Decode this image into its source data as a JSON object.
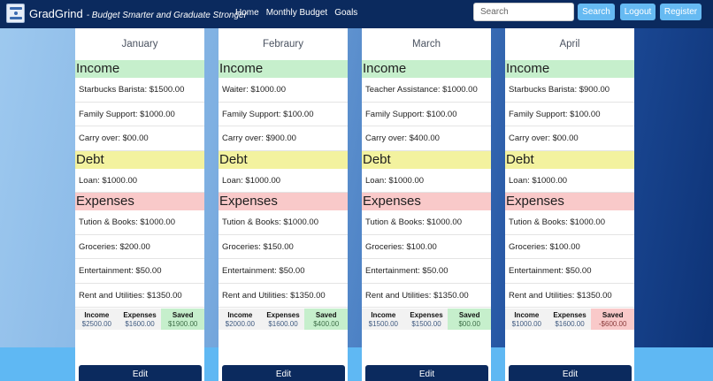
{
  "nav": {
    "brand": "GradGrind",
    "tagline": "- Budget Smarter and Graduate Stronger",
    "links": [
      "Home",
      "Monthly Budget",
      "Goals"
    ],
    "search_placeholder": "Search",
    "search_button": "Search",
    "logout": "Logout",
    "register": "Register",
    "logo_icon": "budget-logo-icon"
  },
  "sections": {
    "income": "Income",
    "debt": "Debt",
    "expenses": "Expenses"
  },
  "summary_labels": {
    "income": "Income",
    "expenses": "Expenses",
    "saved": "Saved"
  },
  "edit_label": "Edit",
  "colors": {
    "navbar": "#0b2a5e",
    "income_header": "#c6efcc",
    "debt_header": "#f3f29f",
    "expenses_header": "#f9c9c9",
    "nav_button": "#66baf2"
  },
  "months": [
    {
      "name": "January",
      "income": [
        "Starbucks Barista: $1500.00",
        "Family Support: $1000.00",
        "Carry over: $00.00"
      ],
      "debt": [
        "Loan: $1000.00"
      ],
      "expenses": [
        "Tution & Books: $1000.00",
        "Groceries: $200.00",
        "Entertainment: $50.00",
        "Rent and Utilities: $1350.00"
      ],
      "summary": {
        "income": "$2500.00",
        "expenses": "$1600.00",
        "saved": "$1900.00"
      }
    },
    {
      "name": "Febraury",
      "income": [
        "Waiter: $1000.00",
        "Family Support: $100.00",
        "Carry over: $900.00"
      ],
      "debt": [
        "Loan: $1000.00"
      ],
      "expenses": [
        "Tution & Books: $1000.00",
        "Groceries: $150.00",
        "Entertainment: $50.00",
        "Rent and Utilities: $1350.00"
      ],
      "summary": {
        "income": "$2000.00",
        "expenses": "$1600.00",
        "saved": "$400.00"
      }
    },
    {
      "name": "March",
      "income": [
        "Teacher Assistance: $1000.00",
        "Family Support: $100.00",
        "Carry over: $400.00"
      ],
      "debt": [
        "Loan: $1000.00"
      ],
      "expenses": [
        "Tution & Books: $1000.00",
        "Groceries: $100.00",
        "Entertainment: $50.00",
        "Rent and Utilities: $1350.00"
      ],
      "summary": {
        "income": "$1500.00",
        "expenses": "$1500.00",
        "saved": "$00.00"
      }
    },
    {
      "name": "April",
      "income": [
        "Starbucks Barista: $900.00",
        "Family Support: $100.00",
        "Carry over: $00.00"
      ],
      "debt": [
        "Loan: $1000.00"
      ],
      "expenses": [
        "Tution & Books: $1000.00",
        "Groceries: $100.00",
        "Entertainment: $50.00",
        "Rent and Utilities: $1350.00"
      ],
      "summary": {
        "income": "$1000.00",
        "expenses": "$1600.00",
        "saved": "-$600.00"
      }
    }
  ]
}
